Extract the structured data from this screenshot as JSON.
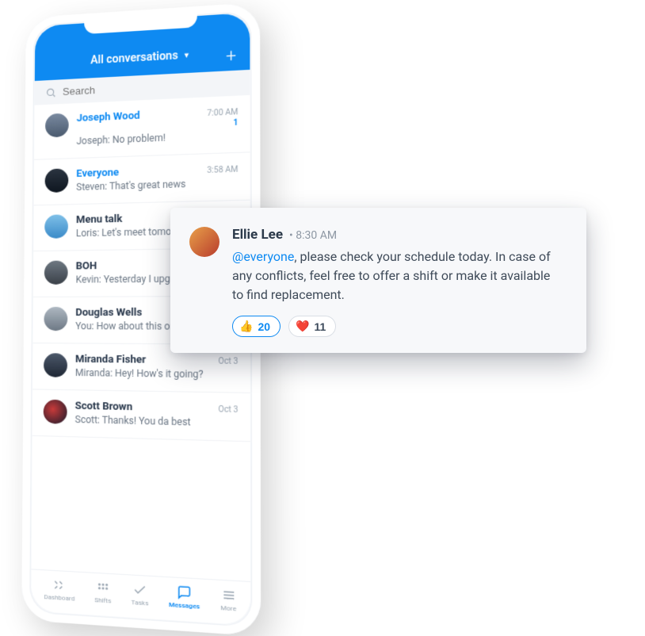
{
  "header": {
    "title": "All conversations",
    "plus_glyph": "+"
  },
  "search": {
    "placeholder": "Search"
  },
  "conversations": [
    {
      "name": "Joseph Wood",
      "preview": "Joseph: No problem!",
      "time": "7:00 AM",
      "unread": true,
      "badge": "1"
    },
    {
      "name": "Everyone",
      "preview": "Steven: That's great news",
      "time": "3:58 AM",
      "unread": true,
      "badge": ""
    },
    {
      "name": "Menu talk",
      "preview": "Loris: Let's meet tomorro",
      "time": "",
      "unread": false,
      "badge": ""
    },
    {
      "name": "BOH",
      "preview": "Kevin: Yesterday I upgrad",
      "time": "",
      "unread": false,
      "badge": ""
    },
    {
      "name": "Douglas Wells",
      "preview": "You: How about this one?",
      "time": "",
      "unread": false,
      "badge": ""
    },
    {
      "name": "Miranda Fisher",
      "preview": "Miranda: Hey! How's it going?",
      "time": "Oct 3",
      "unread": false,
      "badge": ""
    },
    {
      "name": "Scott Brown",
      "preview": "Scott: Thanks! You da best",
      "time": "Oct 3",
      "unread": false,
      "badge": ""
    }
  ],
  "tabs": [
    {
      "label": "Dashboard"
    },
    {
      "label": "Shifts"
    },
    {
      "label": "Tasks"
    },
    {
      "label": "Messages"
    },
    {
      "label": "More"
    }
  ],
  "card": {
    "name": "Ellie Lee",
    "time": "8:30 AM",
    "mention": "@everyone",
    "body_rest": ", please check your schedule today. In case of any conflicts, feel free to offer a shift or make it available to find replacement.",
    "reactions": [
      {
        "emoji": "👍",
        "count": "20"
      },
      {
        "emoji": "❤️",
        "count": "11"
      }
    ]
  }
}
